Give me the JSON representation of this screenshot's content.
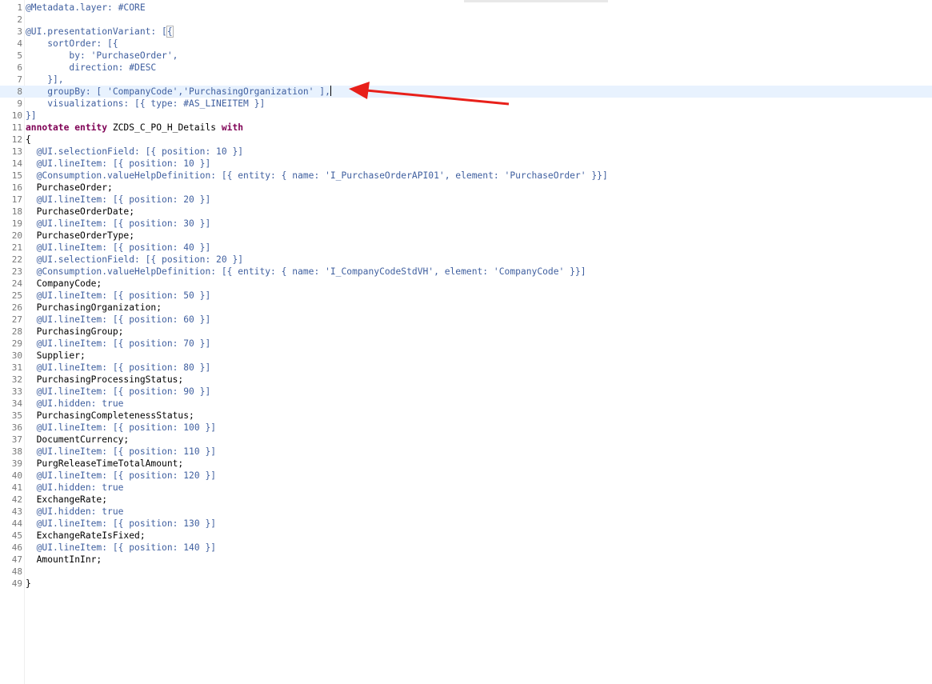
{
  "editor": {
    "current_line": 8,
    "lines": [
      {
        "n": "1",
        "t": "@Metadata.layer: #CORE"
      },
      {
        "n": "2",
        "t": ""
      },
      {
        "n": "3",
        "t": "@UI.presentationVariant: [{"
      },
      {
        "n": "4",
        "t": "    sortOrder: [{"
      },
      {
        "n": "5",
        "t": "        by: 'PurchaseOrder',"
      },
      {
        "n": "6",
        "t": "        direction: #DESC"
      },
      {
        "n": "7",
        "t": "    }],"
      },
      {
        "n": "8",
        "t": "    groupBy: [ 'CompanyCode','PurchasingOrganization' ],"
      },
      {
        "n": "9",
        "t": "    visualizations: [{ type: #AS_LINEITEM }]"
      },
      {
        "n": "10",
        "t": "}]"
      },
      {
        "n": "11",
        "t": "annotate entity ZCDS_C_PO_H_Details with"
      },
      {
        "n": "12",
        "t": "{"
      },
      {
        "n": "13",
        "t": "  @UI.selectionField: [{ position: 10 }]"
      },
      {
        "n": "14",
        "t": "  @UI.lineItem: [{ position: 10 }]"
      },
      {
        "n": "15",
        "t": "  @Consumption.valueHelpDefinition: [{ entity: { name: 'I_PurchaseOrderAPI01', element: 'PurchaseOrder' }}]"
      },
      {
        "n": "16",
        "t": "  PurchaseOrder;"
      },
      {
        "n": "17",
        "t": "  @UI.lineItem: [{ position: 20 }]"
      },
      {
        "n": "18",
        "t": "  PurchaseOrderDate;"
      },
      {
        "n": "19",
        "t": "  @UI.lineItem: [{ position: 30 }]"
      },
      {
        "n": "20",
        "t": "  PurchaseOrderType;"
      },
      {
        "n": "21",
        "t": "  @UI.lineItem: [{ position: 40 }]"
      },
      {
        "n": "22",
        "t": "  @UI.selectionField: [{ position: 20 }]"
      },
      {
        "n": "23",
        "t": "  @Consumption.valueHelpDefinition: [{ entity: { name: 'I_CompanyCodeStdVH', element: 'CompanyCode' }}]"
      },
      {
        "n": "24",
        "t": "  CompanyCode;"
      },
      {
        "n": "25",
        "t": "  @UI.lineItem: [{ position: 50 }]"
      },
      {
        "n": "26",
        "t": "  PurchasingOrganization;"
      },
      {
        "n": "27",
        "t": "  @UI.lineItem: [{ position: 60 }]"
      },
      {
        "n": "28",
        "t": "  PurchasingGroup;"
      },
      {
        "n": "29",
        "t": "  @UI.lineItem: [{ position: 70 }]"
      },
      {
        "n": "30",
        "t": "  Supplier;"
      },
      {
        "n": "31",
        "t": "  @UI.lineItem: [{ position: 80 }]"
      },
      {
        "n": "32",
        "t": "  PurchasingProcessingStatus;"
      },
      {
        "n": "33",
        "t": "  @UI.lineItem: [{ position: 90 }]"
      },
      {
        "n": "34",
        "t": "  @UI.hidden: true"
      },
      {
        "n": "35",
        "t": "  PurchasingCompletenessStatus;"
      },
      {
        "n": "36",
        "t": "  @UI.lineItem: [{ position: 100 }]"
      },
      {
        "n": "37",
        "t": "  DocumentCurrency;"
      },
      {
        "n": "38",
        "t": "  @UI.lineItem: [{ position: 110 }]"
      },
      {
        "n": "39",
        "t": "  PurgReleaseTimeTotalAmount;"
      },
      {
        "n": "40",
        "t": "  @UI.lineItem: [{ position: 120 }]"
      },
      {
        "n": "41",
        "t": "  @UI.hidden: true"
      },
      {
        "n": "42",
        "t": "  ExchangeRate;"
      },
      {
        "n": "43",
        "t": "  @UI.hidden: true"
      },
      {
        "n": "44",
        "t": "  @UI.lineItem: [{ position: 130 }]"
      },
      {
        "n": "45",
        "t": "  ExchangeRateIsFixed;"
      },
      {
        "n": "46",
        "t": "  @UI.lineItem: [{ position: 140 }]"
      },
      {
        "n": "47",
        "t": "  AmountInInr;"
      },
      {
        "n": "48",
        "t": ""
      },
      {
        "n": "49",
        "t": "}"
      }
    ]
  },
  "colors": {
    "keyword": "#7f0055",
    "annotation": "#3f5f9f",
    "arrow": "#e8201a",
    "current_line": "#e8f2fe"
  }
}
